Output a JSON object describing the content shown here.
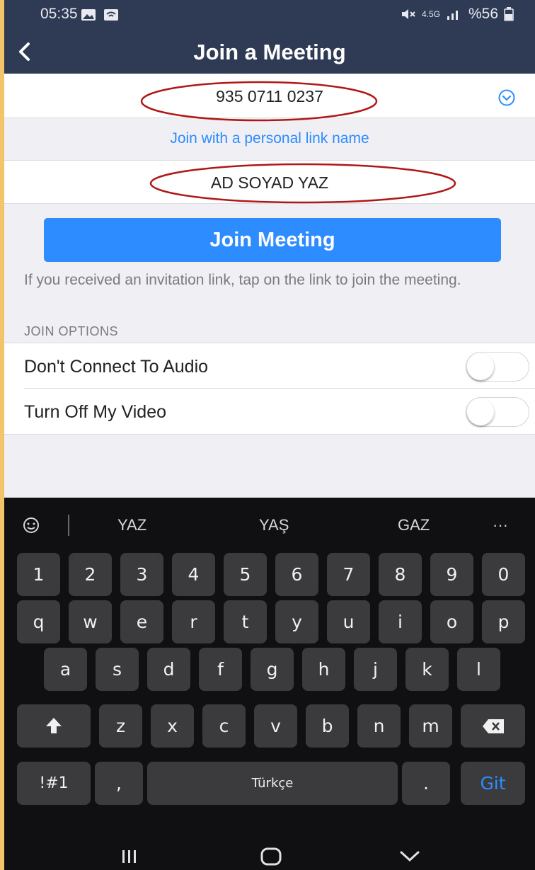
{
  "status_bar": {
    "time": "05:35",
    "network": "4.5G",
    "battery": "%56"
  },
  "header": {
    "title": "Join a Meeting"
  },
  "meeting_id": {
    "value": "935 0711 0237"
  },
  "personal_link": {
    "label": "Join with a personal link name"
  },
  "name_field": {
    "value": "AD SOYAD YAZ"
  },
  "join_button": {
    "label": "Join Meeting"
  },
  "help_text": "If you received an invitation link, tap on the link to join the meeting.",
  "join_options": {
    "header": "JOIN OPTIONS",
    "items": [
      {
        "label": "Don't Connect To Audio",
        "enabled": false
      },
      {
        "label": "Turn Off My Video",
        "enabled": false
      }
    ]
  },
  "keyboard": {
    "suggestions": [
      "YAZ",
      "YAŞ",
      "GAZ"
    ],
    "more": "···",
    "row_numbers": [
      "1",
      "2",
      "3",
      "4",
      "5",
      "6",
      "7",
      "8",
      "9",
      "0"
    ],
    "row1": [
      "q",
      "w",
      "e",
      "r",
      "t",
      "y",
      "u",
      "i",
      "o",
      "p"
    ],
    "row2": [
      "a",
      "s",
      "d",
      "f",
      "g",
      "h",
      "j",
      "k",
      "l"
    ],
    "row3": [
      "z",
      "x",
      "c",
      "v",
      "b",
      "n",
      "m"
    ],
    "symbols_key": "!#1",
    "comma_key": ",",
    "space_key": "Türkçe",
    "period_key": ".",
    "go_key": "Git"
  },
  "colors": {
    "accent": "#2d8cff",
    "header_bg": "#2f3a55",
    "annotation": "#b01818"
  }
}
